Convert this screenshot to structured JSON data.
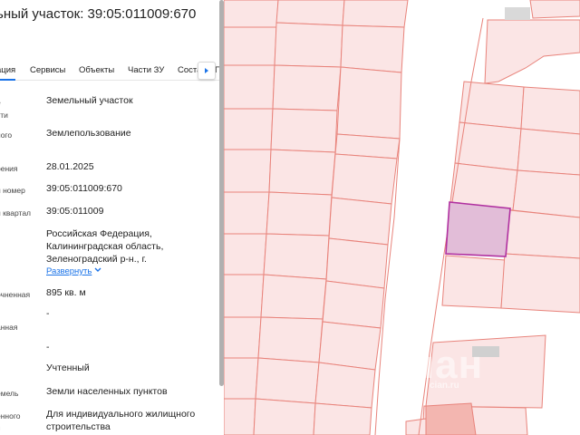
{
  "panel": {
    "title": "ьный участок: 39:05:011009:670",
    "tabs": [
      {
        "label": "ация"
      },
      {
        "label": "Сервисы"
      },
      {
        "label": "Объекты"
      },
      {
        "label": "Части ЗУ"
      },
      {
        "label": "Соста"
      },
      {
        "label": "Г"
      }
    ],
    "rows": [
      {
        "label": "е",
        "label2": "сти",
        "value": "Земельный участок"
      },
      {
        "label": "ного",
        "value": "Землепользование"
      },
      {
        "label": "рения",
        "value": "28.01.2025"
      },
      {
        "label": "й номер",
        "value": "39:05:011009:670"
      },
      {
        "label": "й квартал",
        "value": "39:05:011009"
      },
      {
        "value_lines": [
          "Российская Федерация,",
          "Калининградская область,",
          "Зеленоградский р-н., г."
        ]
      },
      {
        "label": "очненная",
        "value": "895 кв. м"
      },
      {
        "label": "анная",
        "value": "-"
      },
      {
        "value": "-"
      },
      {
        "value": "Учтенный"
      },
      {
        "label": "емель",
        "value": "Земли населенных пунктов"
      },
      {
        "label": "енного",
        "label2": "я",
        "value_lines": [
          "Для индивидуального жилищного",
          "строительства"
        ]
      }
    ],
    "expand_link": "Развернуть"
  },
  "map": {
    "watermark": "циан",
    "watermark_sub": "cian.ru"
  },
  "colors": {
    "accent": "#1a73e8",
    "parcel_fill": "#fbe5e5",
    "parcel_border": "#e8837b",
    "selected_fill": "#e2bdd8",
    "selected_border": "#b030a0"
  }
}
